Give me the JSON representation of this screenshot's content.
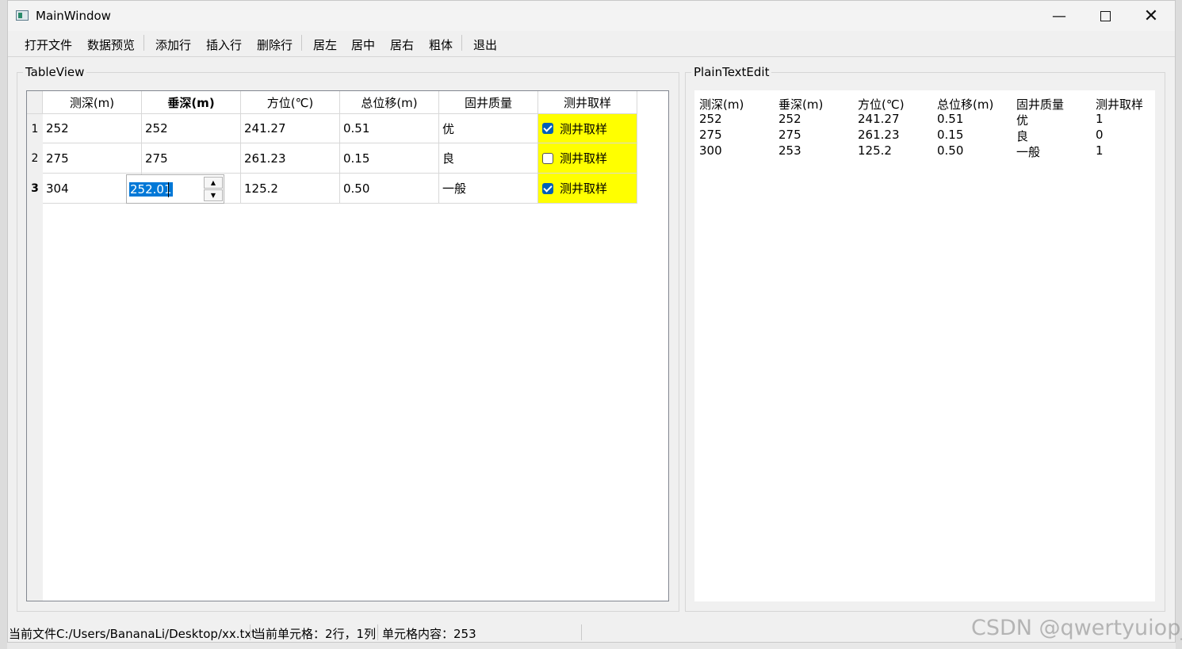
{
  "window": {
    "title": "MainWindow"
  },
  "menubar": {
    "items": [
      "打开文件",
      "数据预览",
      "添加行",
      "插入行",
      "删除行",
      "居左",
      "居中",
      "居右",
      "粗体",
      "退出"
    ]
  },
  "table_group": {
    "title": "TableView"
  },
  "table": {
    "headers": [
      "测深(m)",
      "垂深(m)",
      "方位(℃)",
      "总位移(m)",
      "固井质量",
      "测井取样"
    ],
    "row_headers": [
      "1",
      "2",
      "3"
    ],
    "rows": [
      {
        "c0": "252",
        "c1": "252",
        "c2": "241.27",
        "c3": "0.51",
        "c4": "优",
        "check_label": "测井取样",
        "checked": true
      },
      {
        "c0": "275",
        "c1": "275",
        "c2": "261.23",
        "c3": "0.15",
        "c4": "良",
        "check_label": "测井取样",
        "checked": false
      },
      {
        "c0": "304",
        "c1": "252.01",
        "c2": "125.2",
        "c3": "0.50",
        "c4": "一般",
        "check_label": "测井取样",
        "checked": true
      }
    ],
    "editing": {
      "row": 3,
      "column": 2,
      "value": "252.01"
    },
    "highlight_color": "#ffff00",
    "selection_color": "#0078d7"
  },
  "text_group": {
    "title": "PlainTextEdit"
  },
  "plain_text": {
    "lines": [
      [
        "测深(m)",
        "垂深(m)",
        "方位(℃)",
        "总位移(m)",
        "固井质量",
        "测井取样"
      ],
      [
        "252",
        "252",
        "241.27",
        "0.51",
        "优",
        "1"
      ],
      [
        "275",
        "275",
        "261.23",
        "0.15",
        "良",
        "0"
      ],
      [
        "300",
        "253",
        "125.2",
        "0.50",
        "一般",
        "1"
      ]
    ]
  },
  "statusbar": {
    "file": "当前文件C:/Users/BananaLi/Desktop/xx.txt",
    "cell": "当前单元格：2行，1列",
    "content": "单元格内容：253"
  },
  "watermark": "CSDN @qwertyuiop_i"
}
